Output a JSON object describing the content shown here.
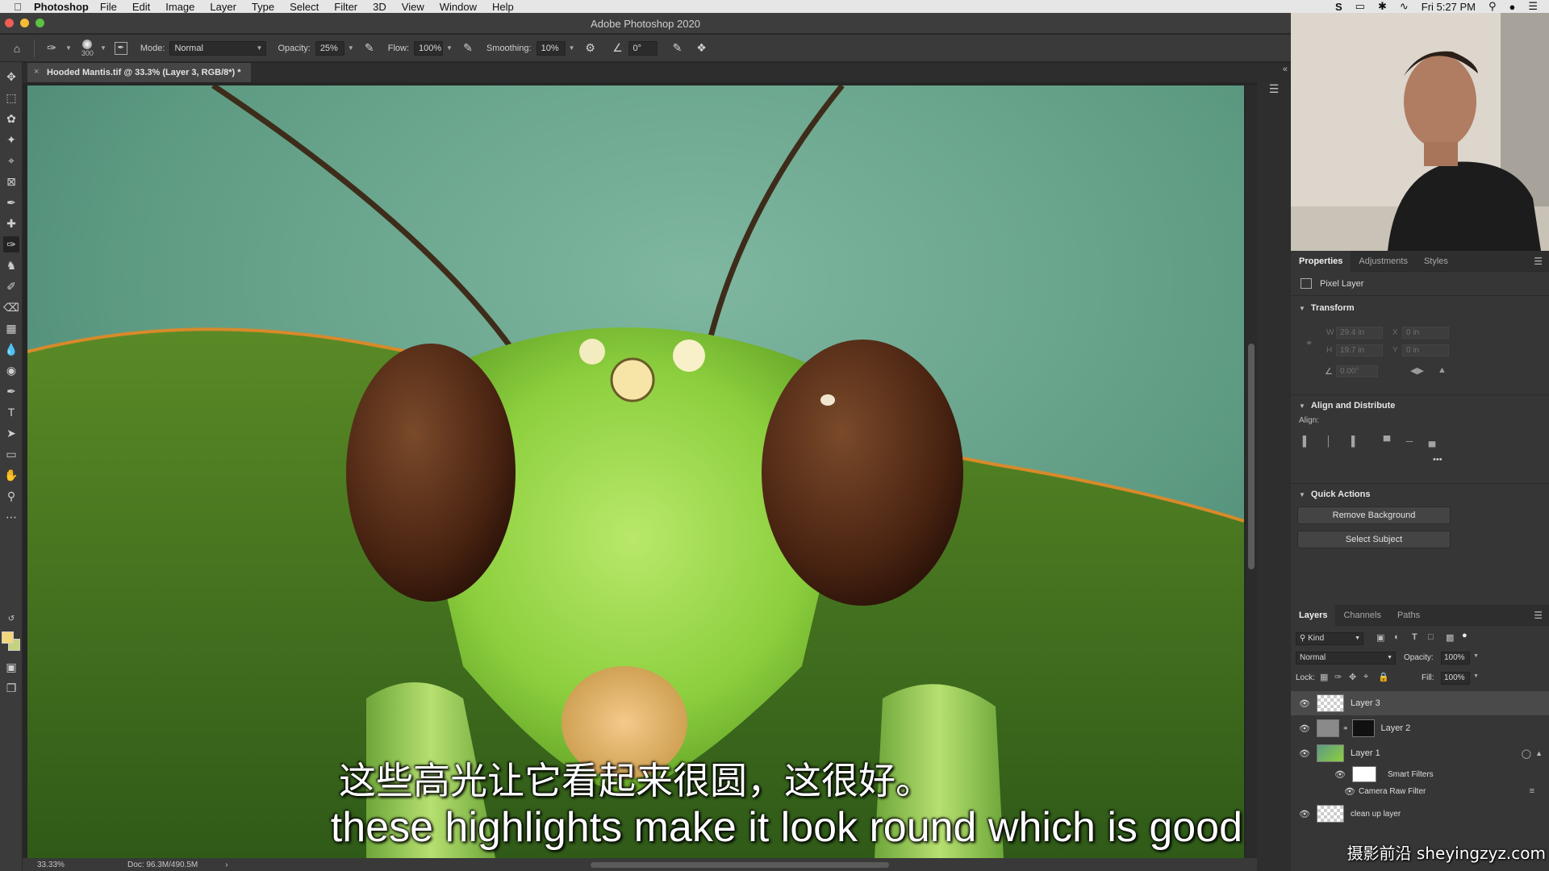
{
  "menubar": {
    "app_name": "Photoshop",
    "items": [
      "File",
      "Edit",
      "Image",
      "Layer",
      "Type",
      "Select",
      "Filter",
      "3D",
      "View",
      "Window",
      "Help"
    ],
    "clock": "Fri 5:27 PM",
    "icons": [
      "skype-icon",
      "airplay-icon",
      "bluetooth-icon",
      "wifi-icon",
      "search-icon",
      "user-icon",
      "list-icon"
    ]
  },
  "window": {
    "title": "Adobe Photoshop 2020"
  },
  "options": {
    "brush_size": "300",
    "mode_label": "Mode:",
    "mode_value": "Normal",
    "opacity_label": "Opacity:",
    "opacity_value": "25%",
    "flow_label": "Flow:",
    "flow_value": "100%",
    "smoothing_label": "Smoothing:",
    "smoothing_value": "10%",
    "angle_value": "0°"
  },
  "document": {
    "tab_title": "Hooded Mantis.tif @ 33.3% (Layer 3, RGB/8*) *",
    "zoom": "33.33%",
    "doc_size": "Doc: 96.3M/490.5M"
  },
  "subtitles": {
    "chinese": "这些高光让它看起来很圆，这很好。",
    "english": "these highlights make it look round which is good"
  },
  "properties": {
    "tabs": [
      "Properties",
      "Adjustments",
      "Styles"
    ],
    "layer_type": "Pixel Layer",
    "transform_title": "Transform",
    "w_label": "W",
    "h_label": "H",
    "x_label": "X",
    "y_label": "Y",
    "w_value": "29.4 in",
    "h_value": "19.7 in",
    "x_value": "0 in",
    "y_value": "0 in",
    "angle_value": "0.00°",
    "align_title": "Align and Distribute",
    "align_label": "Align:",
    "more": "•••",
    "quick_actions_title": "Quick Actions",
    "remove_background": "Remove Background",
    "select_subject": "Select Subject"
  },
  "layers_panel": {
    "tabs": [
      "Layers",
      "Channels",
      "Paths"
    ],
    "kind_label": "Kind",
    "blend_mode": "Normal",
    "opacity_label": "Opacity:",
    "opacity_value": "100%",
    "lock_label": "Lock:",
    "fill_label": "Fill:",
    "fill_value": "100%",
    "layers": [
      {
        "name": "Layer 3",
        "selected": true
      },
      {
        "name": "Layer 2",
        "selected": false
      },
      {
        "name": "Layer 1",
        "selected": false
      },
      {
        "name": "Smart Filters",
        "selected": false
      },
      {
        "name": "Camera Raw Filter",
        "selected": false
      },
      {
        "name": "clean up layer",
        "selected": false
      }
    ]
  },
  "watermark": "摄影前沿 sheyingzyz.com",
  "colors": {
    "foreground": "#f1d77a",
    "background": "#c5d27c",
    "canvas_bg": "#558c76",
    "mantis_green": "#8ccf3e"
  }
}
